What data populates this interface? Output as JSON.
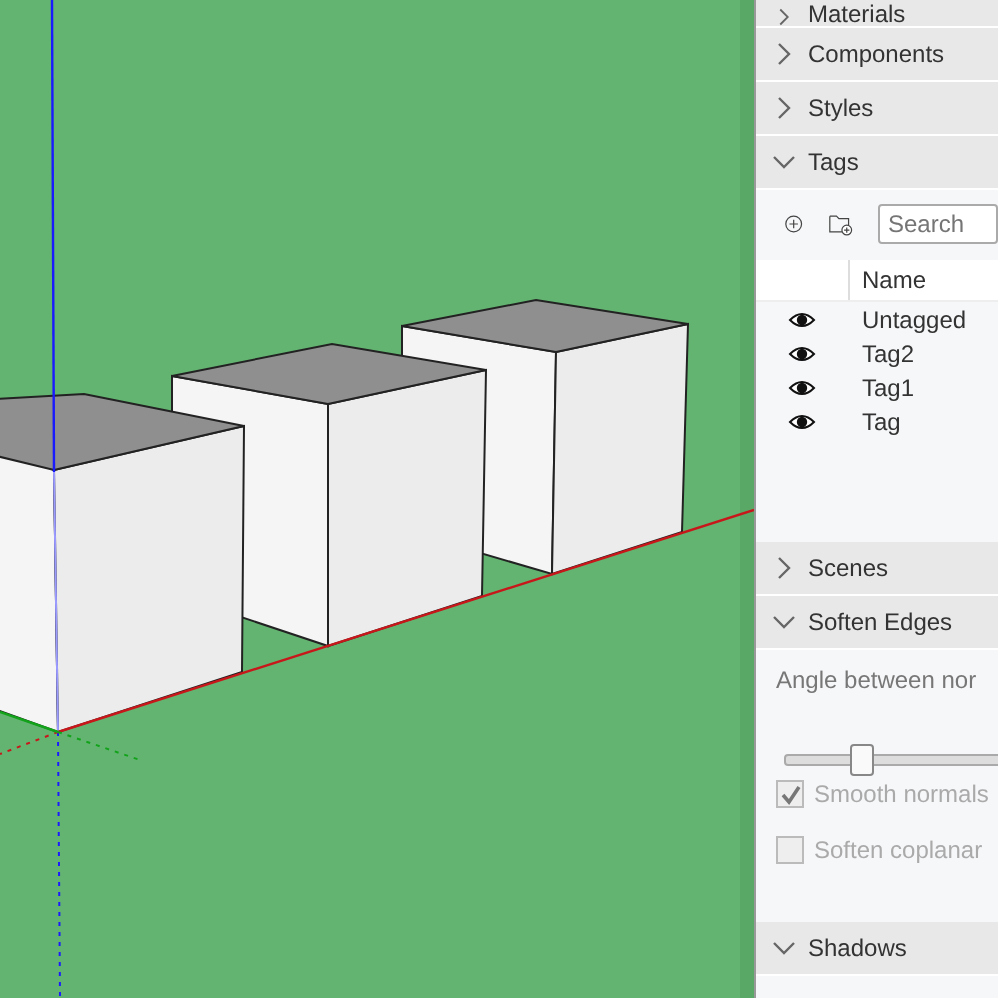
{
  "tray": {
    "sections": [
      {
        "title": "Materials",
        "expanded": false
      },
      {
        "title": "Components",
        "expanded": false
      },
      {
        "title": "Styles",
        "expanded": false
      },
      {
        "title": "Tags",
        "expanded": true,
        "kind": "tags"
      },
      {
        "title": "Scenes",
        "expanded": false
      },
      {
        "title": "Soften Edges",
        "expanded": true,
        "kind": "soften"
      },
      {
        "title": "Shadows",
        "expanded": true,
        "kind": "plain"
      }
    ]
  },
  "tags": {
    "search": {
      "placeholder": "Search"
    },
    "column": "Name",
    "rows": [
      {
        "name": "Untagged",
        "visible": true
      },
      {
        "name": "Tag2",
        "visible": true
      },
      {
        "name": "Tag1",
        "visible": true
      },
      {
        "name": "Tag",
        "visible": true
      }
    ]
  },
  "soften_edges": {
    "label": "Angle between nor",
    "level": 0.16,
    "options": [
      {
        "label": "Smooth normals",
        "checked": true,
        "disabled": true
      },
      {
        "label": "Soften coplanar",
        "checked": false,
        "disabled": true
      }
    ]
  }
}
